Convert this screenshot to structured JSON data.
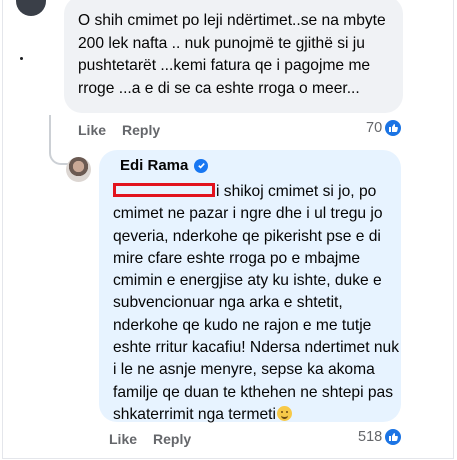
{
  "comment1": {
    "text": "O shih cmimet po leji ndërtimet..se na mbyte 200 lek nafta .. nuk punojmë te gjithë si ju pushtetarët ...kemi fatura qe i pagojme me rroge ...a e di se ca eshte rroga o meer...",
    "like_label": "Like",
    "reply_label": "Reply",
    "reaction_count": "70"
  },
  "reply": {
    "author": "Edi Rama",
    "text_before": "i shikoj cmimet si jo, po cmimet ne pazar i ngre dhe i ul tregu jo qeveria, nderkohe qe pikerisht pse e di mire cfare eshte rroga po e mbajme cmimin e energjise aty ku ishte, duke e subvencionuar nga arka e shtetit, nderkohe qe kudo ne rajon e me tutje eshte rritur kacafiu! Ndersa ndertimet nuk i le ne asnje menyre, sepse ka akoma familje qe duan te kthehen ne shtepi pas shkaterrimit nga termeti",
    "like_label": "Like",
    "reply_label": "Reply",
    "reaction_count": "518"
  },
  "colors": {
    "accent": "#1877f2",
    "bubble_gray": "#f0f2f5",
    "bubble_blue": "#e7f3ff",
    "redaction": "#e2131e"
  }
}
